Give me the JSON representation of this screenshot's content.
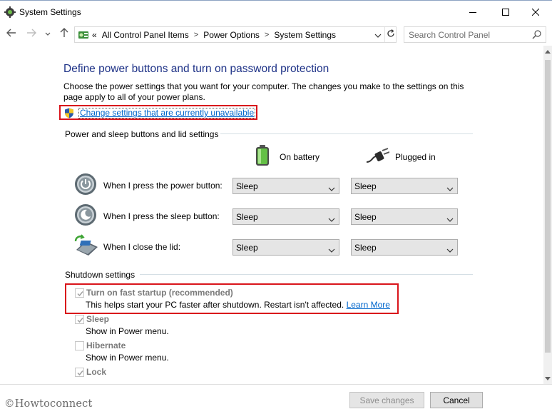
{
  "window": {
    "title": "System Settings",
    "icons": {
      "app": "settings-cog-icon",
      "minimize": "minimize-icon",
      "maximize": "maximize-icon",
      "close": "close-icon"
    }
  },
  "navigation": {
    "back": "back-arrow-icon",
    "forward": "forward-arrow-icon",
    "recent": "recent-pages-chevron-icon",
    "up": "up-arrow-icon",
    "overflow": "«",
    "breadcrumbs": [
      "All Control Panel Items",
      "Power Options",
      "System Settings"
    ],
    "separator": ">",
    "search_placeholder": "Search Control Panel"
  },
  "main": {
    "title": "Define power buttons and turn on password protection",
    "description": "Choose the power settings that you want for your computer. The changes you make to the settings on this page apply to all of your power plans.",
    "change_link": "Change settings that are currently unavailable",
    "power_section": {
      "heading": "Power and sleep buttons and lid settings",
      "col_battery": "On battery",
      "col_plugged": "Plugged in",
      "rows": [
        {
          "label": "When I press the power button:",
          "battery": "Sleep",
          "plugged": "Sleep",
          "icon": "power-button-icon"
        },
        {
          "label": "When I press the sleep button:",
          "battery": "Sleep",
          "plugged": "Sleep",
          "icon": "sleep-button-icon"
        },
        {
          "label": "When I close the lid:",
          "battery": "Sleep",
          "plugged": "Sleep",
          "icon": "laptop-lid-icon"
        }
      ]
    },
    "shutdown_section": {
      "heading": "Shutdown settings",
      "options": [
        {
          "title": "Turn on fast startup (recommended)",
          "desc": "This helps start your PC faster after shutdown. Restart isn't affected.",
          "link": "Learn More",
          "checked": true
        },
        {
          "title": "Sleep",
          "desc": "Show in Power menu.",
          "checked": true
        },
        {
          "title": "Hibernate",
          "desc": "Show in Power menu.",
          "checked": false
        },
        {
          "title": "Lock",
          "desc": "",
          "checked": true
        }
      ]
    }
  },
  "footer": {
    "watermark": "©Howtoconnect",
    "save": "Save changes",
    "cancel": "Cancel"
  },
  "colors": {
    "title_blue": "#1e3287",
    "link_blue": "#0066cc",
    "highlight_red": "#d9141b"
  }
}
